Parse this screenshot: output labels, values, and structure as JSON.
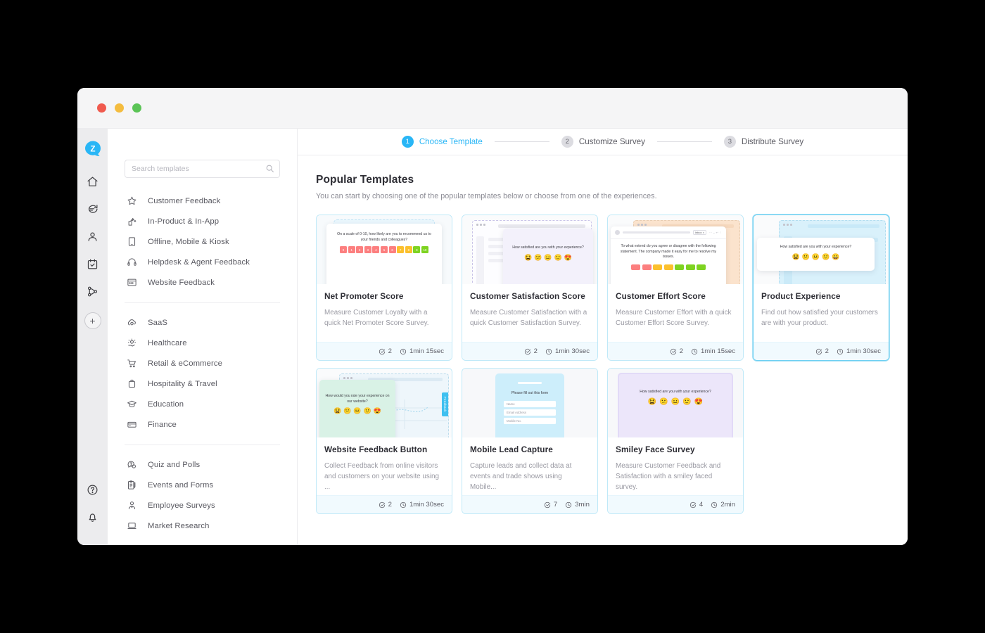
{
  "window": {
    "traffic_lights": [
      "close",
      "minimize",
      "maximize"
    ]
  },
  "rail": {
    "logo_letter": "Z",
    "items": [
      {
        "name": "home-icon",
        "label": "Home"
      },
      {
        "name": "feedback-icon",
        "label": "Feedback"
      },
      {
        "name": "contacts-icon",
        "label": "Contacts"
      },
      {
        "name": "tasks-icon",
        "label": "Tasks"
      },
      {
        "name": "workflow-icon",
        "label": "Workflows"
      }
    ],
    "add_label": "+",
    "bottom_items": [
      {
        "name": "help-icon",
        "label": "Help"
      },
      {
        "name": "notification-icon",
        "label": "Notifications"
      }
    ]
  },
  "search": {
    "placeholder": "Search templates",
    "value": ""
  },
  "nav": {
    "group1": [
      {
        "label": "Customer Feedback",
        "icon": "star-icon"
      },
      {
        "label": "In-Product & In-App",
        "icon": "in-app-icon"
      },
      {
        "label": "Offline, Mobile & Kiosk",
        "icon": "tablet-icon"
      },
      {
        "label": "Helpdesk & Agent Feedback",
        "icon": "headset-icon"
      },
      {
        "label": "Website Feedback",
        "icon": "browser-icon"
      }
    ],
    "group2": [
      {
        "label": "SaaS",
        "icon": "cloud-gear-icon"
      },
      {
        "label": "Healthcare",
        "icon": "healthcare-icon"
      },
      {
        "label": "Retail & eCommerce",
        "icon": "cart-icon"
      },
      {
        "label": "Hospitality & Travel",
        "icon": "suitcase-icon"
      },
      {
        "label": "Education",
        "icon": "graduation-cap-icon"
      },
      {
        "label": "Finance",
        "icon": "wallet-icon"
      }
    ],
    "group3": [
      {
        "label": "Quiz and Polls",
        "icon": "quiz-icon"
      },
      {
        "label": "Events and Forms",
        "icon": "clipboard-icon"
      },
      {
        "label": "Employee Surveys",
        "icon": "employee-icon"
      },
      {
        "label": "Market Research",
        "icon": "laptop-icon"
      }
    ]
  },
  "stepper": {
    "steps": [
      {
        "number": "1",
        "label": "Choose Template",
        "active": true
      },
      {
        "number": "2",
        "label": "Customize Survey",
        "active": false
      },
      {
        "number": "3",
        "label": "Distribute Survey",
        "active": false
      }
    ],
    "active_color": "#29b6f6"
  },
  "content": {
    "title": "Popular Templates",
    "subtitle": "You can start by choosing one of the popular templates below or choose from one of the experiences."
  },
  "cards": [
    {
      "title": "Net Promoter Score",
      "desc": "Measure Customer Loyalty with a quick Net Promoter Score Survey.",
      "questions": "2",
      "duration": "1min 15sec",
      "selected": false,
      "preview": {
        "kind": "nps",
        "question": "On a scale of 0-10, how likely are you to recommend us to your friends and colleagues?",
        "scale": [
          "0",
          "1",
          "2",
          "3",
          "4",
          "5",
          "6",
          "7",
          "8",
          "9",
          "10"
        ],
        "scale_colors": [
          "#fc7f7f",
          "#fc7f7f",
          "#fc7f7f",
          "#fc7f7f",
          "#fc7f7f",
          "#fc7f7f",
          "#fc7f7f",
          "#fbc02d",
          "#fbc02d",
          "#7ed321",
          "#7ed321"
        ]
      }
    },
    {
      "title": "Customer Satisfaction Score",
      "desc": "Measure Customer Satisfaction with a quick Customer Satisfaction Survey.",
      "questions": "2",
      "duration": "1min 30sec",
      "selected": false,
      "preview": {
        "kind": "csat",
        "question": "How satisfied are you with your experience?",
        "emojis": [
          "😫",
          "😕",
          "😐",
          "🙂",
          "😍"
        ],
        "bg": "#f3f1fb"
      }
    },
    {
      "title": "Customer Effort Score",
      "desc": "Measure Customer Effort with a quick Customer Effort Score Survey.",
      "questions": "2",
      "duration": "1min 15sec",
      "selected": false,
      "preview": {
        "kind": "ces",
        "question": "To what extend do you agree or disagree with the following statement. The company made it easy for me to resolve my issues.",
        "mail_tag": "Inbox ×",
        "bars": [
          "#fc7f7f",
          "#fc7f7f",
          "#fbc02d",
          "#fbc02d",
          "#7ed321",
          "#7ed321",
          "#7ed321"
        ],
        "bg": "#fbe3cd"
      }
    },
    {
      "title": "Product Experience",
      "desc": "Find out how satisfied your customers are with your product.",
      "questions": "2",
      "duration": "1min 30sec",
      "selected": true,
      "preview": {
        "kind": "pex",
        "question": "How satisfied are you with your experience?",
        "emojis": [
          "😫",
          "😕",
          "😐",
          "🙂",
          "😀"
        ],
        "bg": "#d9f1fb"
      }
    },
    {
      "title": "Website Feedback Button",
      "desc": "Collect Feedback from online visitors and customers on your website using ...",
      "questions": "2",
      "duration": "1min 30sec",
      "selected": false,
      "preview": {
        "kind": "wfb",
        "question": "How would you rate your experience on our website?",
        "emojis": [
          "😫",
          "😕",
          "😐",
          "🙂",
          "😍"
        ],
        "tab_label": "Feedback",
        "bg": "#d9f2e6"
      }
    },
    {
      "title": "Mobile Lead Capture",
      "desc": "Capture leads and collect data at events and trade shows using Mobile...",
      "questions": "7",
      "duration": "3min",
      "selected": false,
      "preview": {
        "kind": "mlc",
        "question": "Please fill out this form",
        "fields": [
          "Name",
          "Email Address",
          "Mobile No."
        ],
        "bg": "#cdeefb"
      }
    },
    {
      "title": "Smiley Face Survey",
      "desc": "Measure Customer Feedback and Satisfaction with a smiley faced survey.",
      "questions": "4",
      "duration": "2min",
      "selected": false,
      "preview": {
        "kind": "sfs",
        "question": "How satisfied are you with your experience?",
        "emojis": [
          "😫",
          "😕",
          "😐",
          "🙂",
          "😍"
        ],
        "bg": "#ece6fa"
      }
    }
  ],
  "icons": {
    "check_circle": "check-circle-icon",
    "clock": "clock-icon"
  }
}
